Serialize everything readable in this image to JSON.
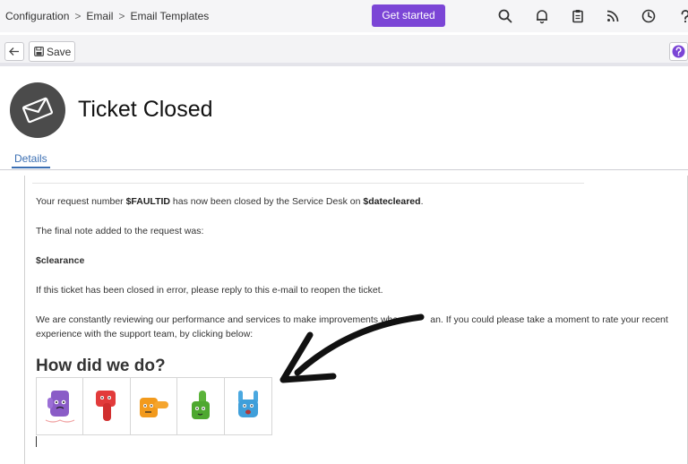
{
  "breadcrumb": [
    "Configuration",
    "Email",
    "Email Templates"
  ],
  "header": {
    "cta_label": "Get started",
    "icons": [
      "search-icon",
      "bell-icon",
      "clipboard-icon",
      "rss-icon",
      "clock-icon",
      "help-icon"
    ]
  },
  "toolbar": {
    "back_icon": "arrow-left-icon",
    "save_label": "Save",
    "help_icon": "question-icon"
  },
  "record": {
    "icon": "envelope-icon",
    "title": "Ticket Closed"
  },
  "tabs": [
    {
      "label": "Details",
      "active": true
    }
  ],
  "email": {
    "line1_a": "Your request number ",
    "line1_var1": "$FAULTID",
    "line1_b": " has now been closed by the Service Desk on ",
    "line1_var2": "$datecleared",
    "line1_c": ".",
    "line2": "The final note added to the request was:",
    "line3": "$clearance",
    "line4": "If this ticket has been closed in error, please reply to this e-mail to reopen the ticket.",
    "line5a": "We are constantly reviewing our performance and services to make improvements whe",
    "line5a_tail": "an. If you could please take a moment to rate your recent",
    "line5b": "experience with the support team, by clicking below:",
    "heading": "How did we do?",
    "ratings": [
      "angry-face-icon",
      "thumbs-down-icon",
      "thumbs-sideways-icon",
      "thumbs-up-icon",
      "rock-on-icon"
    ]
  },
  "colors": {
    "accent": "#7b45d6",
    "tab": "#3b6fb3",
    "avatar_bg": "#4b4b4b"
  }
}
